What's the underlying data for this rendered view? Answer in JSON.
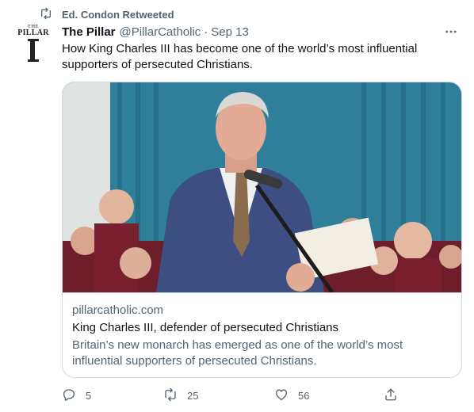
{
  "retweet": {
    "label": "Ed. Condon Retweeted"
  },
  "avatar": {
    "line1": "THE",
    "line2": "PILLAR"
  },
  "header": {
    "name": "The Pillar",
    "handle": "@PillarCatholic",
    "separator": "·",
    "date": "Sep 13"
  },
  "tweet": {
    "text": "How King Charles III has become one of the world’s most influential supporters of persecuted Christians."
  },
  "card": {
    "domain": "pillarcatholic.com",
    "title": "King Charles III, defender of persecuted Christians",
    "description": "Britain’s new monarch has emerged as one of the world’s most influential supporters of persecuted Christians."
  },
  "actions": {
    "replies": "5",
    "retweets": "25",
    "likes": "56"
  },
  "colors": {
    "text_primary": "#0f1419",
    "text_secondary": "#536471",
    "border": "#cfd9de",
    "curtain": "#2f7f9a"
  },
  "icons": [
    "retweet-icon",
    "more-icon",
    "reply-icon",
    "like-icon",
    "share-icon"
  ]
}
